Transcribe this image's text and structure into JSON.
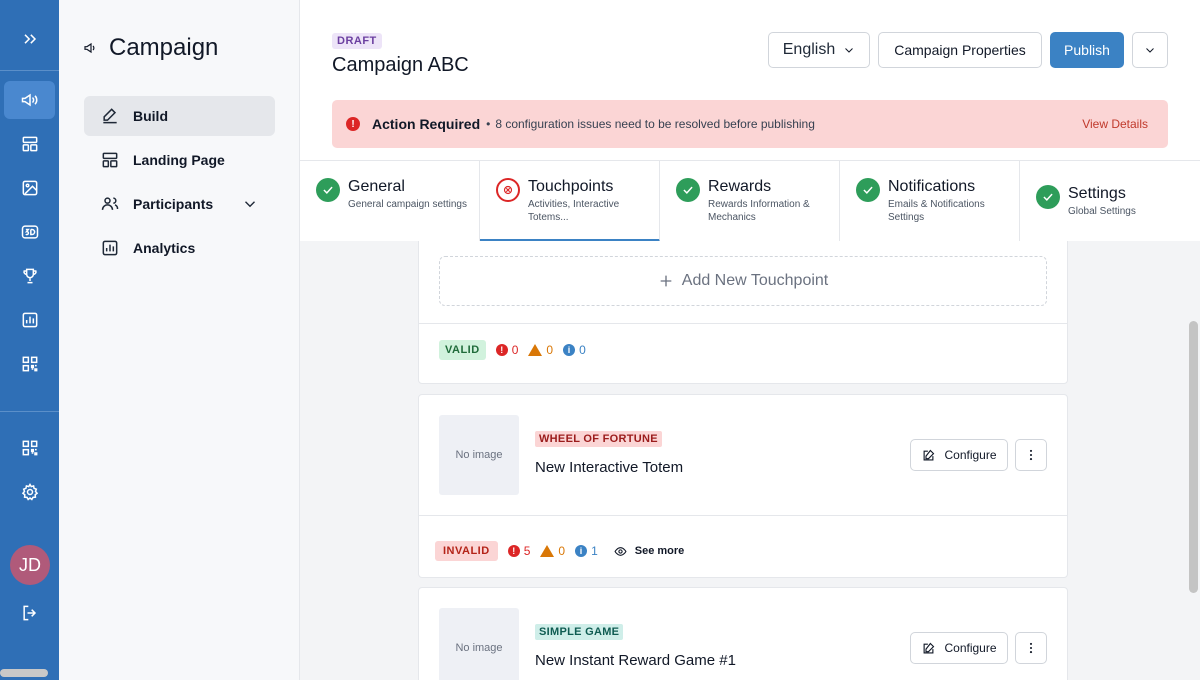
{
  "sidebar": {
    "title": "Campaign",
    "items": [
      {
        "label": "Build"
      },
      {
        "label": "Landing Page"
      },
      {
        "label": "Participants"
      },
      {
        "label": "Analytics"
      }
    ]
  },
  "user": {
    "initials": "JD"
  },
  "header": {
    "status_badge": "DRAFT",
    "campaign_name": "Campaign ABC",
    "language": "English",
    "properties_label": "Campaign Properties",
    "publish_label": "Publish"
  },
  "alert": {
    "title": "Action Required",
    "separator": "•",
    "message": "8 configuration issues need to be resolved before publishing",
    "link": "View Details"
  },
  "tabs": [
    {
      "name": "General",
      "desc": "General campaign settings",
      "status": "ok"
    },
    {
      "name": "Touchpoints",
      "desc": "Activities, Interactive Totems...",
      "status": "error"
    },
    {
      "name": "Rewards",
      "desc": "Rewards Information & Mechanics",
      "status": "ok"
    },
    {
      "name": "Notifications",
      "desc": "Emails & Notifications Settings",
      "status": "ok"
    },
    {
      "name": "Settings",
      "desc": "Global Settings",
      "status": "ok"
    }
  ],
  "add_touchpoint_label": "Add New Touchpoint",
  "first_status": {
    "badge": "VALID",
    "errors": "0",
    "warnings": "0",
    "infos": "0"
  },
  "touchpoints": [
    {
      "thumb": "No image",
      "type": "WHEEL OF FORTUNE",
      "name": "New Interactive Totem",
      "configure": "Configure",
      "status": {
        "badge": "INVALID",
        "errors": "5",
        "warnings": "0",
        "infos": "1",
        "see_more": "See more"
      }
    },
    {
      "thumb": "No image",
      "type": "SIMPLE GAME",
      "name": "New Instant Reward Game #1",
      "configure": "Configure"
    }
  ],
  "colors": {
    "rail": "#2f6fb6",
    "primary": "#3b82c4",
    "error": "#dc2626",
    "warning": "#d97706",
    "success": "#2e9d5a"
  }
}
